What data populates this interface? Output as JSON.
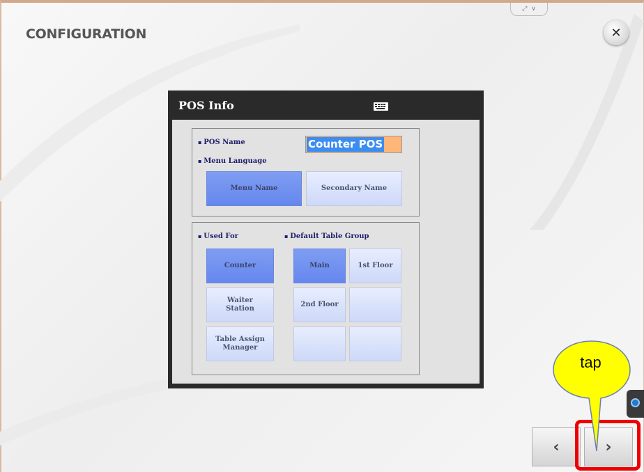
{
  "page": {
    "title": "CONFIGURATION"
  },
  "dialog": {
    "title": "POS Info",
    "pos_name_label": "POS Name",
    "pos_name_value": "Counter POS",
    "menu_language_label": "Menu Language",
    "menu_language_options": [
      {
        "label": "Menu Name",
        "selected": true
      },
      {
        "label": "Secondary Name",
        "selected": false
      }
    ],
    "used_for_label": "Used For",
    "used_for_options": [
      {
        "label": "Counter",
        "selected": true
      },
      {
        "label": "Waiter Station",
        "selected": false
      },
      {
        "label": "Table Assign Manager",
        "selected": false
      }
    ],
    "default_table_group_label": "Default Table Group",
    "table_groups": [
      {
        "label": "Main",
        "selected": true
      },
      {
        "label": "1st Floor",
        "selected": false
      },
      {
        "label": "2nd Floor",
        "selected": false
      },
      {
        "label": "",
        "selected": false
      },
      {
        "label": "",
        "selected": false
      },
      {
        "label": "",
        "selected": false
      }
    ]
  },
  "nav": {
    "prev": "‹",
    "next": "›"
  },
  "annotation": {
    "callout_text": "tap",
    "highlight_color": "#ee0000",
    "callout_color": "#ffff00"
  },
  "icons": {
    "close": "close-icon",
    "keyboard": "keyboard-icon",
    "teamviewer": "remote-support-icon"
  },
  "colors": {
    "selected_button": "#6f8ff0",
    "unselected_button": "#d9e2fb",
    "name_field_bg": "#ffb678",
    "name_highlight": "#3b8df2"
  }
}
